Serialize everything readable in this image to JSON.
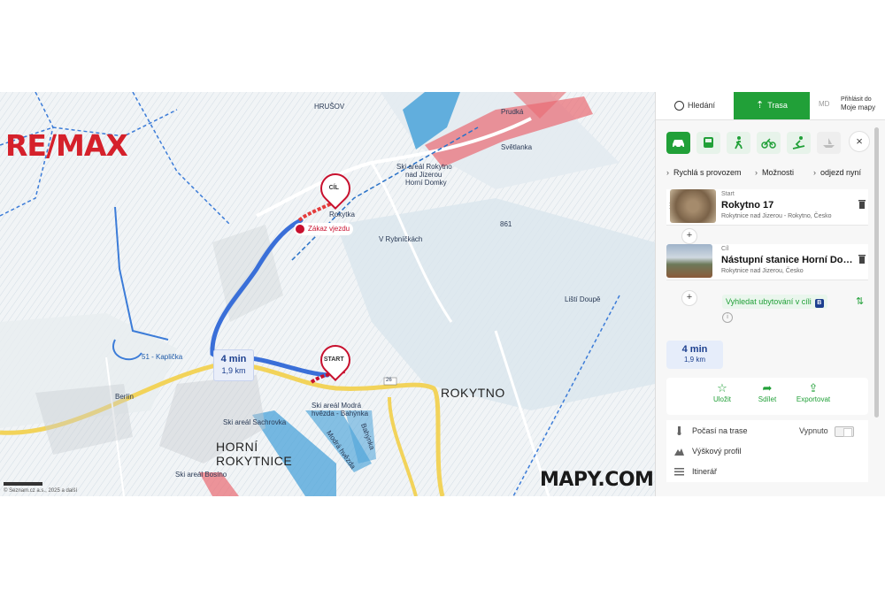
{
  "brand": {
    "remax": "RE/MAX",
    "mapy_logo": "MAPY.COM"
  },
  "map": {
    "labels": {
      "hrusov": "HRUŠOV",
      "prudka": "Prudká",
      "svetlanka": "Světlanka",
      "ski_rokytno": "Ski areál Rokytno",
      "nad_jizerou": "nad Jizerou",
      "horni_domky": "Horní Domky",
      "v_rybnickach": "V Rybníčkách",
      "elev_861": "861",
      "lipsky": "Liští Doupě",
      "kaplicka": "51 - Kaplička",
      "berlin": "Berlín",
      "horni": "HORNÍ",
      "rokytnice": "ROKYTNICE",
      "rokytno": "ROKYTNO",
      "ski_modra": "Ski areál Modrá",
      "hvezda": "hvězda - Bahýnka",
      "ski_sachrovka": "Ski areál Sachrovka",
      "ski_bosino": "Ski areál Bosíno",
      "modra_hvezda": "Modrá hvězda",
      "bahynka": "Bahýnka",
      "road_26": "26",
      "rokytka": "Rokytka"
    },
    "pin_cil": "CÍL",
    "pin_start": "START",
    "warning": "Zákaz vjezdu",
    "route_time": "4 min",
    "route_distance": "1,9 km",
    "copyright": "© Seznam.cz a.s., 2025 a další"
  },
  "panel": {
    "tabs": {
      "search": "Hledání",
      "route": "Trasa",
      "md": "MD",
      "login_line1": "Přihlásit do",
      "login_line2": "Moje mapy"
    },
    "modes": [
      {
        "name": "car-icon",
        "active": true
      },
      {
        "name": "bus-icon",
        "active": false
      },
      {
        "name": "walk-icon",
        "active": false
      },
      {
        "name": "bike-icon",
        "active": false
      },
      {
        "name": "ski-icon",
        "active": false
      },
      {
        "name": "boat-icon",
        "active": false
      }
    ],
    "close": "×",
    "chips": [
      "Rychlá s provozem",
      "Možnosti",
      "odjezd nyní"
    ],
    "start": {
      "label": "Start",
      "name": "Rokytno 17",
      "sub": "Rokytnice nad Jizerou - Rokytno, Česko"
    },
    "end": {
      "label": "Cíl",
      "name": "Nástupní stanice Horní Do…",
      "sub": "Rokytnice nad Jizerou, Česko"
    },
    "plus": "+",
    "accommodation": "Vyhledat ubytování v cíli",
    "accommodation_badge": "B",
    "info": "i",
    "summary": {
      "time": "4 min",
      "distance": "1,9 km"
    },
    "actions": [
      {
        "icon": "☆",
        "label": "Uložit"
      },
      {
        "icon": "➦",
        "label": "Sdílet"
      },
      {
        "icon": "⇪",
        "label": "Exportovat"
      }
    ],
    "options": {
      "weather": "Počasí na trase",
      "weather_value": "Vypnuto",
      "elevation": "Výškový profil",
      "itinerary": "Itinerář"
    }
  },
  "colors": {
    "accent_green": "#21a038",
    "route_blue": "#3a6fd8",
    "remax_red": "#d5212b",
    "pin_red": "#c8102e"
  }
}
